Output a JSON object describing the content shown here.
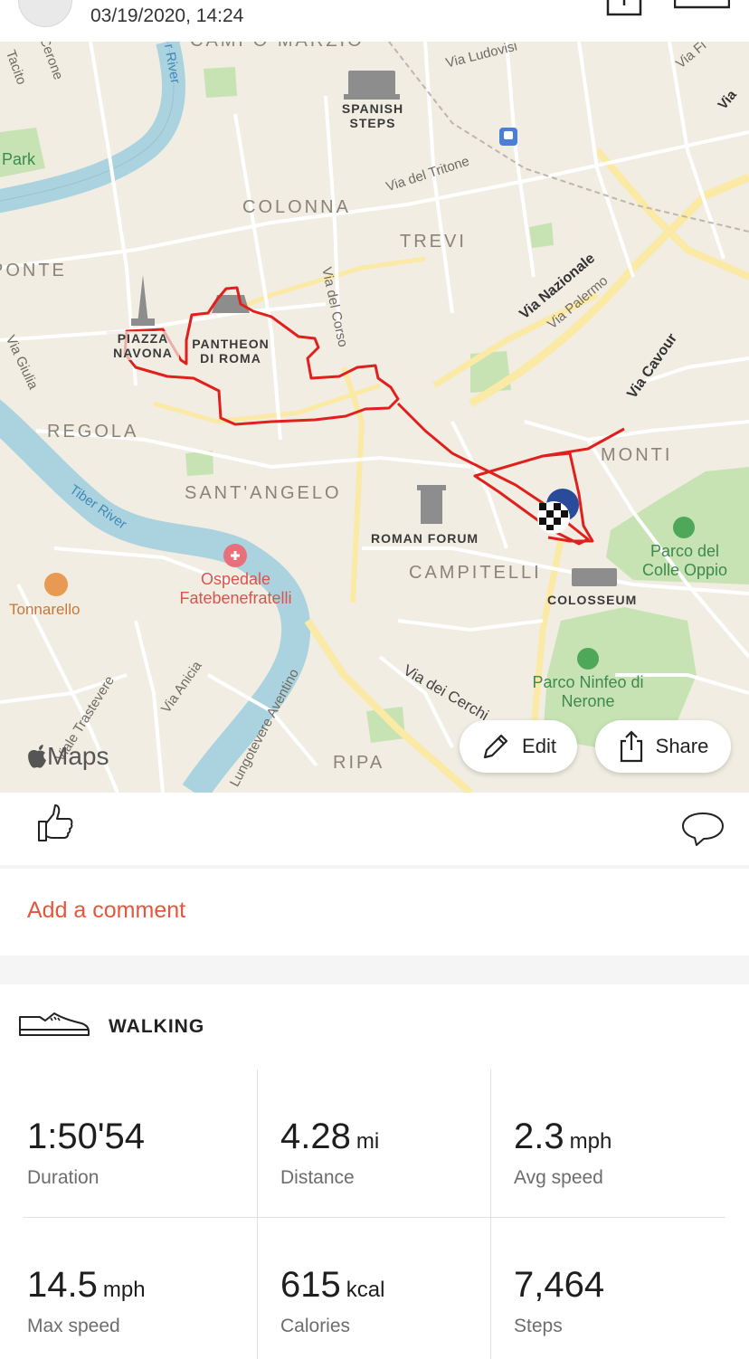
{
  "header": {
    "date": "03/19/2020, 14:24"
  },
  "map": {
    "districts": [
      "CAMPO MARZIO",
      "COLONNA",
      "TREVI",
      "PONTE",
      "REGOLA",
      "SANT'ANGELO",
      "CAMPITELLI",
      "MONTI",
      "RIPA"
    ],
    "pois": [
      "SPANISH STEPS",
      "PIAZZA NAVONA",
      "PANTHEON DI ROMA",
      "ROMAN FORUM",
      "COLOSSEUM"
    ],
    "streets": [
      "Via Ludovisi",
      "Via del Tritone",
      "Via Nazionale",
      "Via Palermo",
      "Via Cavour",
      "Via del Corso",
      "Via dei Cerchi",
      "Via Anicia",
      "Lungotevere Aventino",
      "Viale Trastevere",
      "Via Giulia",
      "Via Fi",
      "Via"
    ],
    "parks": [
      "Park",
      "Parco del Colle Oppio",
      "Parco Ninfeo di Nerone"
    ],
    "river": "Tiber River",
    "river_top": "r River",
    "hospital": "Ospedale Fatebenefratelli",
    "restaurant": "Tonnarello",
    "edge_labels": [
      "Tacito",
      "Cerone"
    ],
    "brand": "Maps",
    "edit_label": "Edit",
    "share_label": "Share"
  },
  "comment": {
    "placeholder": "Add a comment"
  },
  "activity": {
    "type": "WALKING",
    "stats": [
      {
        "value": "1:50'54",
        "unit": "",
        "label": "Duration"
      },
      {
        "value": "4.28",
        "unit": "mi",
        "label": "Distance"
      },
      {
        "value": "2.3",
        "unit": "mph",
        "label": "Avg speed"
      },
      {
        "value": "14.5",
        "unit": "mph",
        "label": "Max speed"
      },
      {
        "value": "615",
        "unit": "kcal",
        "label": "Calories"
      },
      {
        "value": "7,464",
        "unit": "",
        "label": "Steps"
      }
    ]
  },
  "colors": {
    "accent": "#e4573d",
    "route": "#e0201c",
    "water": "#aad3df",
    "park": "#c7e3b3",
    "road": "#fbe9a6"
  }
}
